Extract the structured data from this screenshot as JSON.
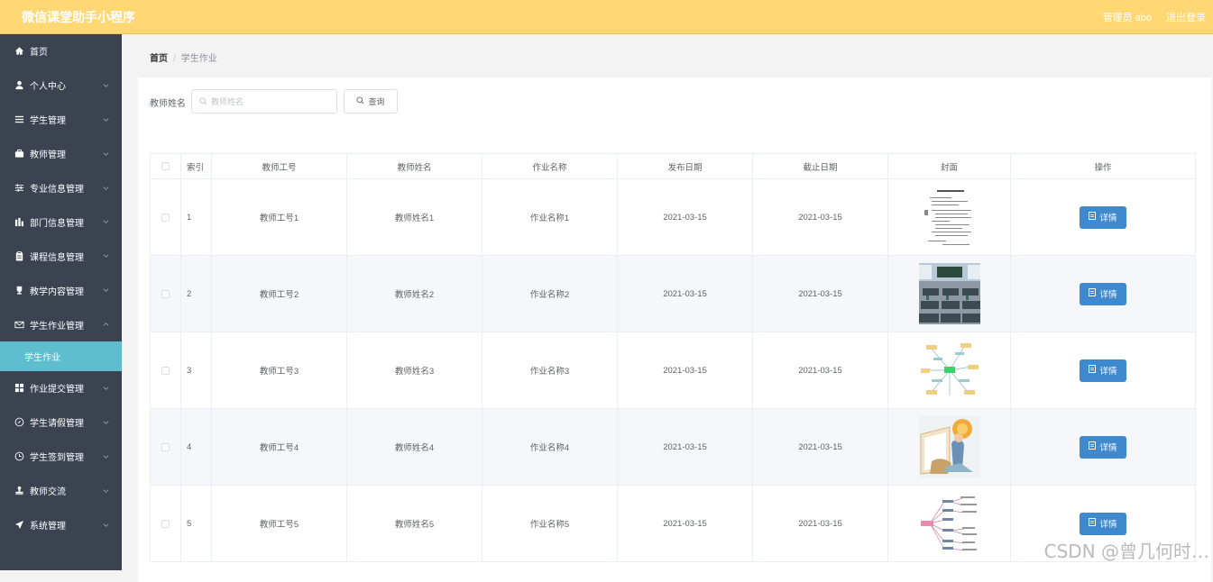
{
  "app": {
    "title": "微信课堂助手小程序"
  },
  "header": {
    "admin_label": "管理员 abo",
    "logout_label": "退出登录"
  },
  "sidebar": {
    "items": [
      {
        "label": "首页",
        "icon": "home-icon",
        "chevron": false
      },
      {
        "label": "个人中心",
        "icon": "user-icon",
        "chevron": true
      },
      {
        "label": "学生管理",
        "icon": "list-icon",
        "chevron": true
      },
      {
        "label": "教师管理",
        "icon": "briefcase-icon",
        "chevron": true
      },
      {
        "label": "专业信息管理",
        "icon": "sliders-icon",
        "chevron": true
      },
      {
        "label": "部门信息管理",
        "icon": "bar-chart-icon",
        "chevron": true
      },
      {
        "label": "课程信息管理",
        "icon": "clipboard-icon",
        "chevron": true
      },
      {
        "label": "教学内容管理",
        "icon": "trophy-icon",
        "chevron": true
      },
      {
        "label": "学生作业管理",
        "icon": "mail-icon",
        "chevron": true,
        "expanded": true
      }
    ],
    "active_sub": "学生作业",
    "items_after": [
      {
        "label": "作业提交管理",
        "icon": "grid-icon",
        "chevron": true
      },
      {
        "label": "学生请假管理",
        "icon": "compass-icon",
        "chevron": true
      },
      {
        "label": "学生签到管理",
        "icon": "clock-icon",
        "chevron": true
      },
      {
        "label": "教师交流",
        "icon": "stamp-icon",
        "chevron": true
      },
      {
        "label": "系统管理",
        "icon": "send-icon",
        "chevron": true
      }
    ]
  },
  "breadcrumb": {
    "home": "首页",
    "separator": "/",
    "current": "学生作业"
  },
  "search": {
    "label": "教师姓名",
    "placeholder": "教师姓名",
    "button_label": "查询"
  },
  "table": {
    "columns": [
      "索引",
      "教师工号",
      "教师姓名",
      "作业名称",
      "发布日期",
      "截止日期",
      "封面",
      "操作"
    ],
    "detail_label": "详情",
    "rows": [
      {
        "index": "1",
        "teacher_id": "教师工号1",
        "teacher_name": "教师姓名1",
        "homework": "作业名称1",
        "publish": "2021-03-15",
        "deadline": "2021-03-15",
        "cover": "document"
      },
      {
        "index": "2",
        "teacher_id": "教师工号2",
        "teacher_name": "教师姓名2",
        "homework": "作业名称2",
        "publish": "2021-03-15",
        "deadline": "2021-03-15",
        "cover": "classroom"
      },
      {
        "index": "3",
        "teacher_id": "教师工号3",
        "teacher_name": "教师姓名3",
        "homework": "作业名称3",
        "publish": "2021-03-15",
        "deadline": "2021-03-15",
        "cover": "mindmap"
      },
      {
        "index": "4",
        "teacher_id": "教师工号4",
        "teacher_name": "教师姓名4",
        "homework": "作业名称4",
        "publish": "2021-03-15",
        "deadline": "2021-03-15",
        "cover": "illustration"
      },
      {
        "index": "5",
        "teacher_id": "教师工号5",
        "teacher_name": "教师姓名5",
        "homework": "作业名称5",
        "publish": "2021-03-15",
        "deadline": "2021-03-15",
        "cover": "mindmap2"
      }
    ]
  },
  "watermark": "CSDN @曾几何时…"
}
